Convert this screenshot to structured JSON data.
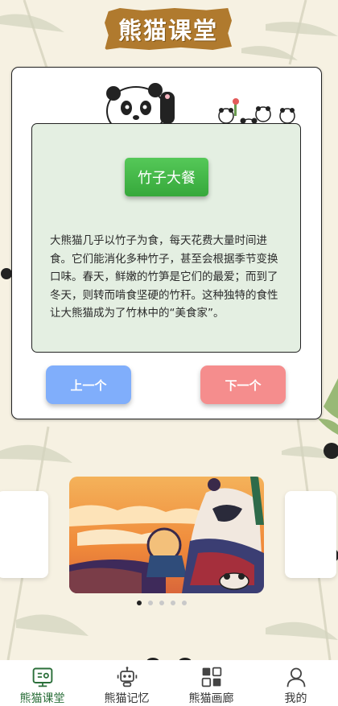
{
  "header": {
    "title": "熊猫课堂"
  },
  "lesson": {
    "topic": "竹子大餐",
    "text": "大熊猫几乎以竹子为食，每天花费大量时间进食。它们能消化多种竹子，甚至会根据季节变换口味。春天，鲜嫩的竹笋是它们的最爱；而到了冬天，则转而啃食坚硬的竹秆。这种独特的食性让大熊猫成为了竹林中的“美食家”。",
    "prev_label": "上一个",
    "next_label": "下一个"
  },
  "carousel": {
    "dot_count": 5,
    "active_index": 0
  },
  "tabbar": {
    "items": [
      {
        "label": "熊猫课堂",
        "icon": "board-icon",
        "active": true
      },
      {
        "label": "熊猫记忆",
        "icon": "robot-icon",
        "active": false
      },
      {
        "label": "熊猫画廊",
        "icon": "grid-icon",
        "active": false
      },
      {
        "label": "我的",
        "icon": "user-icon",
        "active": false
      }
    ]
  },
  "colors": {
    "accent_green": "#36a83b",
    "prev_blue": "#80aefb",
    "next_red": "#f58d8d",
    "banner_brown": "#b07a2e",
    "active_tab": "#2b6f3a"
  }
}
